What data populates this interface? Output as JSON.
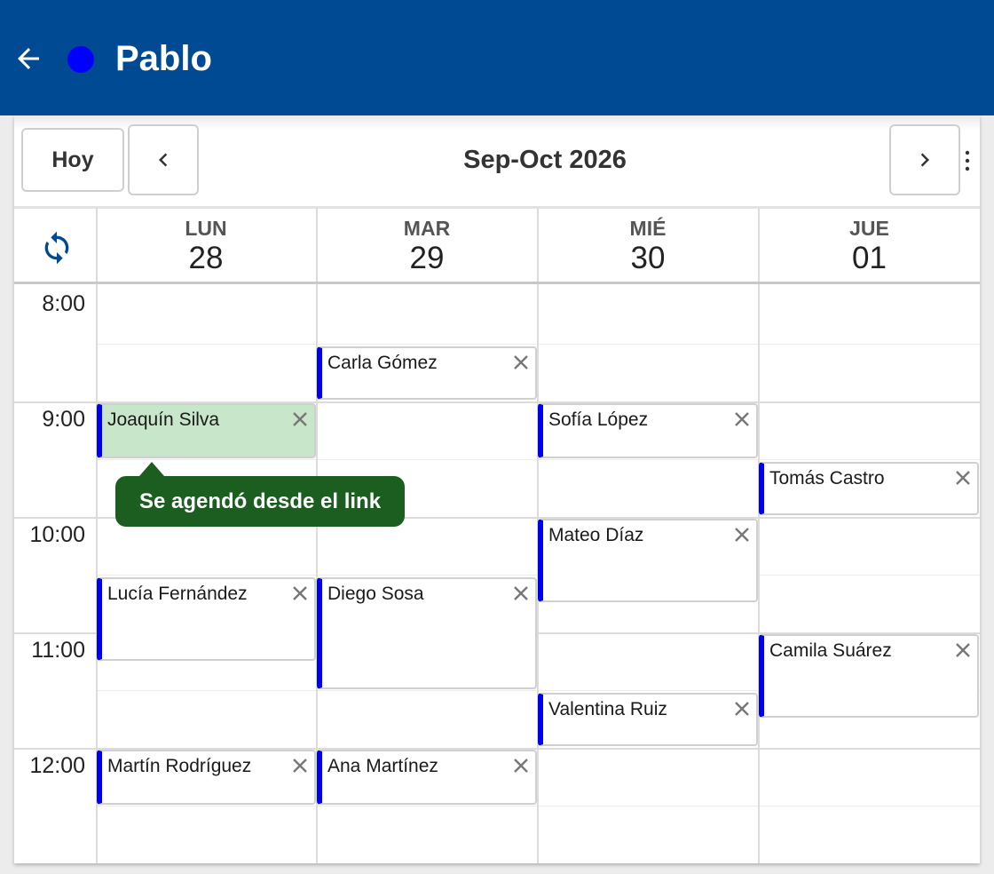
{
  "appbar": {
    "title": "Pablo",
    "status_color": "#0000ff",
    "background": "#004a93"
  },
  "toolbar": {
    "today_label": "Hoy",
    "range_title": "Sep-Oct 2026"
  },
  "days": [
    {
      "name": "LUN",
      "number": "28"
    },
    {
      "name": "MAR",
      "number": "29"
    },
    {
      "name": "MIÉ",
      "number": "30"
    },
    {
      "name": "JUE",
      "number": "01"
    }
  ],
  "times": [
    "8:00",
    "9:00",
    "10:00",
    "11:00",
    "12:00"
  ],
  "events": [
    {
      "name": "Carla Gómez",
      "day": "MAR"
    },
    {
      "name": "Joaquín Silva",
      "day": "LUN",
      "highlighted": true
    },
    {
      "name": "Sofía López",
      "day": "MIÉ"
    },
    {
      "name": "Tomás Castro",
      "day": "JUE"
    },
    {
      "name": "Mateo Díaz",
      "day": "MIÉ"
    },
    {
      "name": "Lucía Fernández",
      "day": "LUN"
    },
    {
      "name": "Diego Sosa",
      "day": "MAR"
    },
    {
      "name": "Camila Suárez",
      "day": "JUE"
    },
    {
      "name": "Valentina Ruiz",
      "day": "MIÉ"
    },
    {
      "name": "Martín Rodríguez",
      "day": "LUN"
    },
    {
      "name": "Ana Martínez",
      "day": "MAR"
    }
  ],
  "tooltip": {
    "text": "Se agendó desde el link"
  },
  "colors": {
    "event_accent": "#0000ee",
    "highlight_bg": "#c8e6c9",
    "tooltip_bg": "#1b5e20"
  }
}
